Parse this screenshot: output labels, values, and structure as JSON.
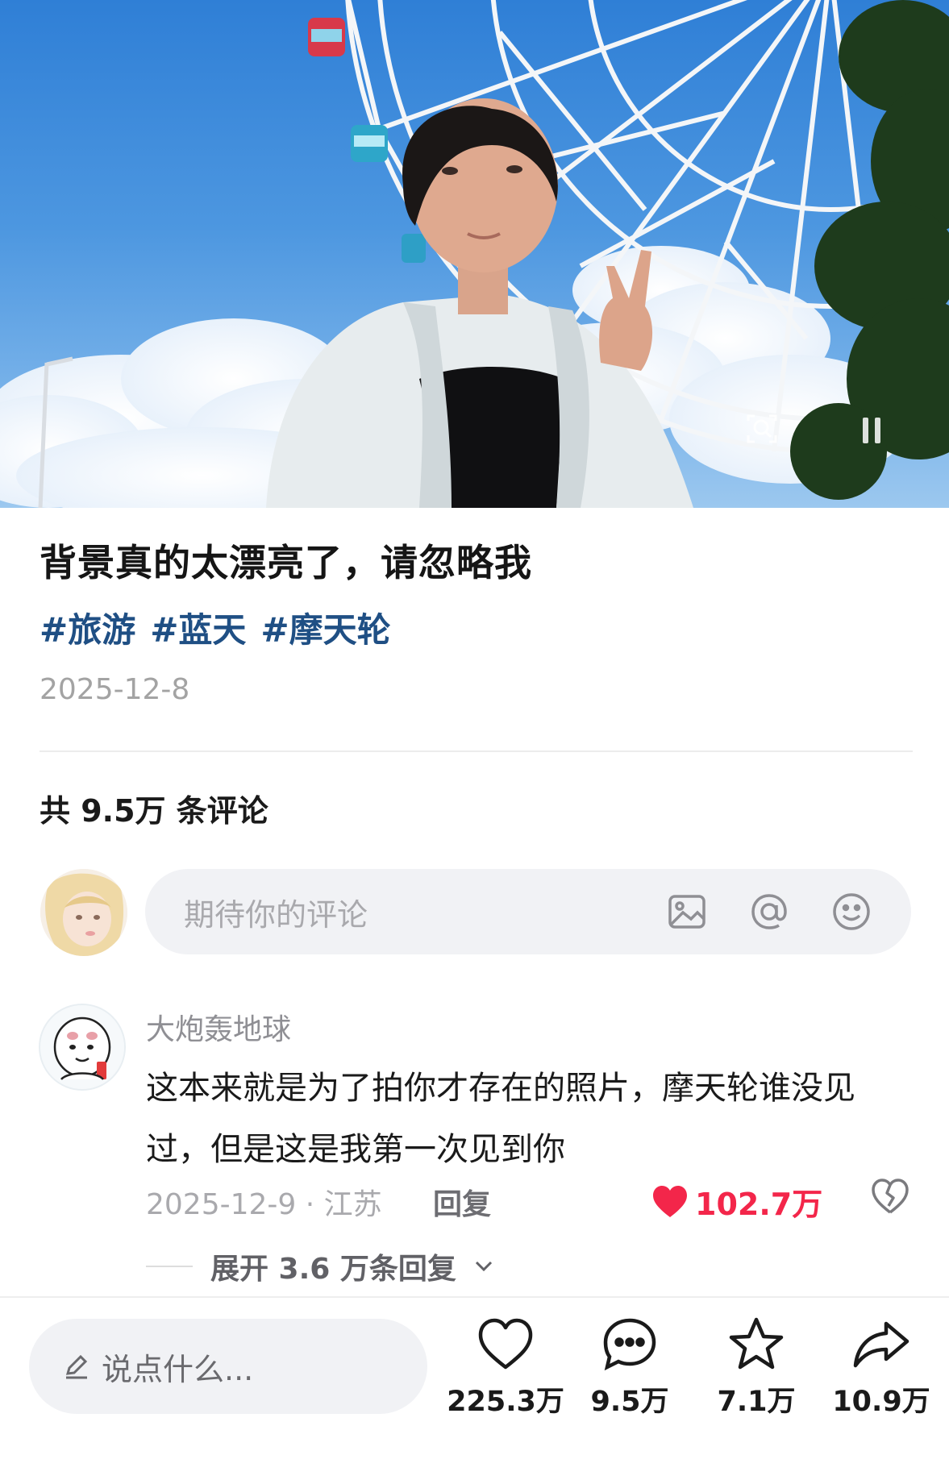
{
  "post": {
    "title": "背景真的太漂亮了，请忽略我",
    "tags": [
      "#旅游",
      "#蓝天",
      "#摩天轮"
    ],
    "date": "2025-12-8",
    "photo_controls": [
      "lens-icon",
      "pause-icon"
    ]
  },
  "comments": {
    "total_label": "共 9.5万 条评论",
    "input_placeholder": "期待你的评论",
    "input_icons": [
      "image-icon",
      "at-icon",
      "emoji-icon"
    ],
    "items": [
      {
        "username": "大炮轰地球",
        "text": "这本来就是为了拍你才存在的照片，摩天轮谁没见过，但是这是我第一次见到你",
        "meta": "2025-12-9 · 江苏",
        "reply_label": "回复",
        "likes": "102.7万",
        "expand_label": "展开 3.6 万条回复"
      }
    ]
  },
  "bottom_bar": {
    "say_placeholder": "说点什么...",
    "likes": "225.3万",
    "comments": "9.5万",
    "favorites": "7.1万",
    "shares": "10.9万"
  },
  "colors": {
    "tag": "#1f4f84",
    "like_red": "#f3264a",
    "muted_text": "#a9a9ad",
    "input_bg": "#f1f2f5"
  }
}
